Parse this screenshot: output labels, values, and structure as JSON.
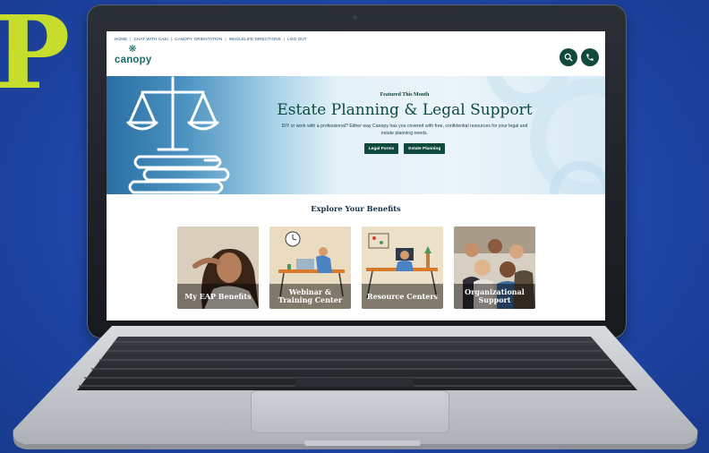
{
  "background": {
    "letter": "P",
    "letter_color": "#c6dd2d",
    "color": "#1f47a8"
  },
  "topnav": {
    "links": [
      "HOME",
      "CHAT WITH CASI",
      "CANOPY ORIENTATION",
      "WHOLELIFE DIRECTIONS",
      "LOG OUT"
    ]
  },
  "header": {
    "logo_text": "canopy",
    "logo_icon": "canopy-leaf-icon",
    "search_icon": "search-icon",
    "phone_icon": "phone-icon",
    "brand_color": "#0f4a3c"
  },
  "hero": {
    "eyebrow": "Featured This Month",
    "title": "Estate Planning & Legal Support",
    "description": "DIY or work with a professional? Either way Canopy has you covered with free, confidential resources for your legal and estate planning needs.",
    "buttons": [
      "Legal Forms",
      "Estate Planning"
    ],
    "illustration": "scales-and-books-icon"
  },
  "explore": {
    "title": "Explore Your Benefits",
    "cards": [
      {
        "label": "My EAP Benefits",
        "image": "smiling-woman-photo"
      },
      {
        "label": "Webinar & Training Center",
        "image": "man-at-laptop-illustration"
      },
      {
        "label": "Resource Centers",
        "image": "person-at-desk-illustration"
      },
      {
        "label": "Organizational Support",
        "image": "group-of-women-photo"
      }
    ]
  }
}
